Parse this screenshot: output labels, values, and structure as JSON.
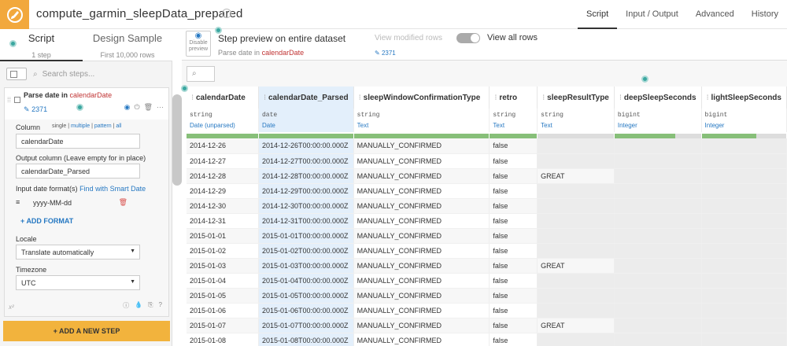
{
  "header": {
    "title": "compute_garmin_sleepData_prepared",
    "nav": [
      "Script",
      "Input / Output",
      "Advanced",
      "History"
    ]
  },
  "left_tabs": {
    "script": {
      "label": "Script",
      "sub": "1 step"
    },
    "design": {
      "label": "Design Sample",
      "sub": "First 10,000 rows"
    }
  },
  "search": {
    "placeholder": "Search steps..."
  },
  "step": {
    "title_prefix": "Parse date in",
    "title_column": "calendarDate",
    "link": "2371",
    "column_label": "Column",
    "column_opts": {
      "single": "single",
      "sep1": " | ",
      "multiple": "multiple",
      "sep2": " | ",
      "pattern": "pattern",
      "sep3": " | ",
      "all": "all"
    },
    "column_value": "calendarDate",
    "output_label": "Output column (Leave empty for in place)",
    "output_value": "calendarDate_Parsed",
    "formats_label": "Input date format(s)",
    "smart_date": "Find with Smart Date",
    "format_value": "yyyy-MM-dd",
    "add_format": "ADD FORMAT",
    "locale_label": "Locale",
    "locale_value": "Translate automatically",
    "timezone_label": "Timezone",
    "timezone_value": "UTC"
  },
  "add_step": "+ ADD A NEW STEP",
  "preview": {
    "disable_label": "Disable preview",
    "title": "Step preview on entire dataset",
    "subtitle_prefix": "Parse date in",
    "subtitle_column": "calendarDate",
    "modified_rows": "View modified rows",
    "all_rows": "View all rows",
    "count": "2371"
  },
  "table": {
    "columns": [
      {
        "name": "calendarDate",
        "type": "string",
        "meaning": "Date (unparsed)",
        "fill": 1.0,
        "hl": false
      },
      {
        "name": "calendarDate_Parsed",
        "type": "date",
        "meaning": "Date",
        "fill": 1.0,
        "hl": true
      },
      {
        "name": "sleepWindowConfirmationType",
        "type": "string",
        "meaning": "Text",
        "fill": 1.0,
        "hl": false
      },
      {
        "name": "retro",
        "type": "string",
        "meaning": "Text",
        "fill": 1.0,
        "hl": false
      },
      {
        "name": "sleepResultType",
        "type": "string",
        "meaning": "Text",
        "fill": 0.0,
        "hl": false
      },
      {
        "name": "deepSleepSeconds",
        "type": "bigint",
        "meaning": "Integer",
        "fill": 0.7,
        "hl": false
      },
      {
        "name": "lightSleepSeconds",
        "type": "bigint",
        "meaning": "Integer",
        "fill": 0.65,
        "hl": false
      }
    ],
    "rows": [
      [
        "2014-12-26",
        "2014-12-26T00:00:00.000Z",
        "MANUALLY_CONFIRMED",
        "false",
        "",
        "",
        ""
      ],
      [
        "2014-12-27",
        "2014-12-27T00:00:00.000Z",
        "MANUALLY_CONFIRMED",
        "false",
        "",
        "",
        ""
      ],
      [
        "2014-12-28",
        "2014-12-28T00:00:00.000Z",
        "MANUALLY_CONFIRMED",
        "false",
        "GREAT",
        "",
        ""
      ],
      [
        "2014-12-29",
        "2014-12-29T00:00:00.000Z",
        "MANUALLY_CONFIRMED",
        "false",
        "",
        "",
        ""
      ],
      [
        "2014-12-30",
        "2014-12-30T00:00:00.000Z",
        "MANUALLY_CONFIRMED",
        "false",
        "",
        "",
        ""
      ],
      [
        "2014-12-31",
        "2014-12-31T00:00:00.000Z",
        "MANUALLY_CONFIRMED",
        "false",
        "",
        "",
        ""
      ],
      [
        "2015-01-01",
        "2015-01-01T00:00:00.000Z",
        "MANUALLY_CONFIRMED",
        "false",
        "",
        "",
        ""
      ],
      [
        "2015-01-02",
        "2015-01-02T00:00:00.000Z",
        "MANUALLY_CONFIRMED",
        "false",
        "",
        "",
        ""
      ],
      [
        "2015-01-03",
        "2015-01-03T00:00:00.000Z",
        "MANUALLY_CONFIRMED",
        "false",
        "GREAT",
        "",
        ""
      ],
      [
        "2015-01-04",
        "2015-01-04T00:00:00.000Z",
        "MANUALLY_CONFIRMED",
        "false",
        "",
        "",
        ""
      ],
      [
        "2015-01-05",
        "2015-01-05T00:00:00.000Z",
        "MANUALLY_CONFIRMED",
        "false",
        "",
        "",
        ""
      ],
      [
        "2015-01-06",
        "2015-01-06T00:00:00.000Z",
        "MANUALLY_CONFIRMED",
        "false",
        "",
        "",
        ""
      ],
      [
        "2015-01-07",
        "2015-01-07T00:00:00.000Z",
        "MANUALLY_CONFIRMED",
        "false",
        "GREAT",
        "",
        ""
      ],
      [
        "2015-01-08",
        "2015-01-08T00:00:00.000Z",
        "MANUALLY_CONFIRMED",
        "false",
        "",
        "",
        ""
      ]
    ]
  },
  "colors": {
    "accent": "#f2a83c",
    "link": "#2678c2",
    "column_highlight": "#e3effb",
    "valid_bar": "#87bf79"
  },
  "icons": [
    "brush-icon",
    "gear-icon",
    "eye-icon",
    "power-icon",
    "trash-icon",
    "more-icon",
    "pencil-icon",
    "search-icon",
    "info-icon",
    "drop-icon",
    "copy-icon",
    "help-icon"
  ]
}
